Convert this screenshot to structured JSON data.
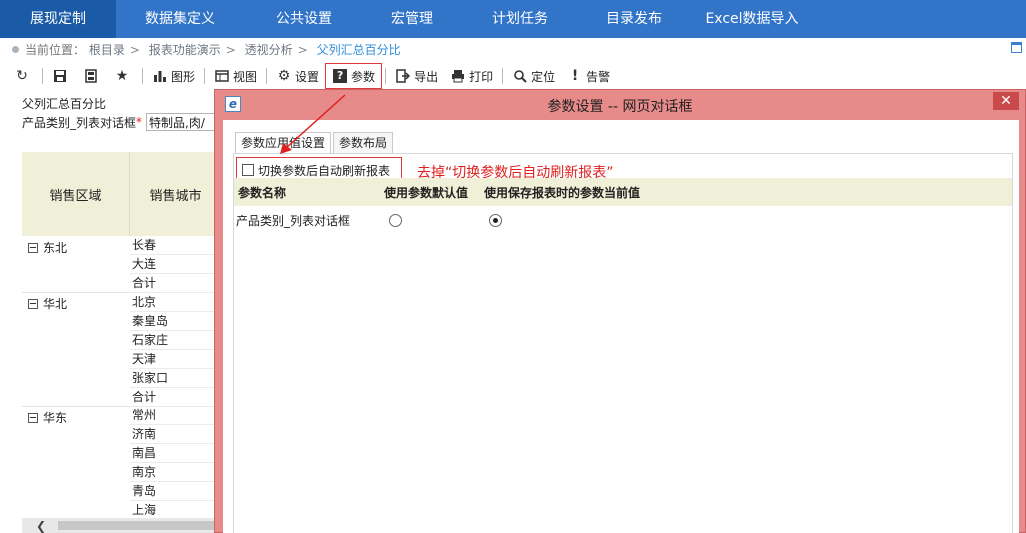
{
  "nav": {
    "items": [
      "展现定制",
      "数据集定义",
      "公共设置",
      "宏管理",
      "计划任务",
      "目录发布",
      "Excel数据导入"
    ],
    "active_index": 0
  },
  "breadcrumb": {
    "label": "当前位置：",
    "items": [
      "根目录",
      "报表功能演示",
      "透视分析"
    ],
    "separator": ">",
    "current": "父列汇总百分比"
  },
  "toolbar": {
    "chart": "图形",
    "view": "视图",
    "settings": "设置",
    "params": "参数",
    "export": "导出",
    "print": "打印",
    "locate": "定位",
    "alert": "告警"
  },
  "report": {
    "title": "父列汇总百分比",
    "param_label": "产品类别_列表对话框",
    "param_required": "*",
    "param_value": "特制品,肉/",
    "headers": [
      "销售区域",
      "销售城市"
    ],
    "groups": [
      {
        "name": "东北",
        "cities": [
          "长春",
          "大连",
          "合计"
        ]
      },
      {
        "name": "华北",
        "cities": [
          "北京",
          "秦皇岛",
          "石家庄",
          "天津",
          "张家口",
          "合计"
        ]
      },
      {
        "name": "华东",
        "cities": [
          "常州",
          "济南",
          "南昌",
          "南京",
          "青岛",
          "上海"
        ]
      }
    ]
  },
  "dialog": {
    "title": "参数设置 -- 网页对话框",
    "close_label": "✕",
    "tabs": [
      "参数应用值设置",
      "参数布局"
    ],
    "active_tab": 0,
    "refresh_label": "切换参数后自动刷新报表",
    "refresh_checked": false,
    "annotation": "去掉“切换参数后自动刷新报表”",
    "columns": [
      "参数名称",
      "使用参数默认值",
      "使用保存报表时的参数当前值"
    ],
    "rows": [
      {
        "name": "产品类别_列表对话框",
        "use_default": false,
        "use_saved": true
      }
    ]
  },
  "colors": {
    "nav_bg": "#3174c8",
    "nav_active": "#1b5aa6",
    "dialog_frame": "#e68a8a",
    "highlight_red": "#e23a3a",
    "table_header_bg": "#f0efd7"
  }
}
